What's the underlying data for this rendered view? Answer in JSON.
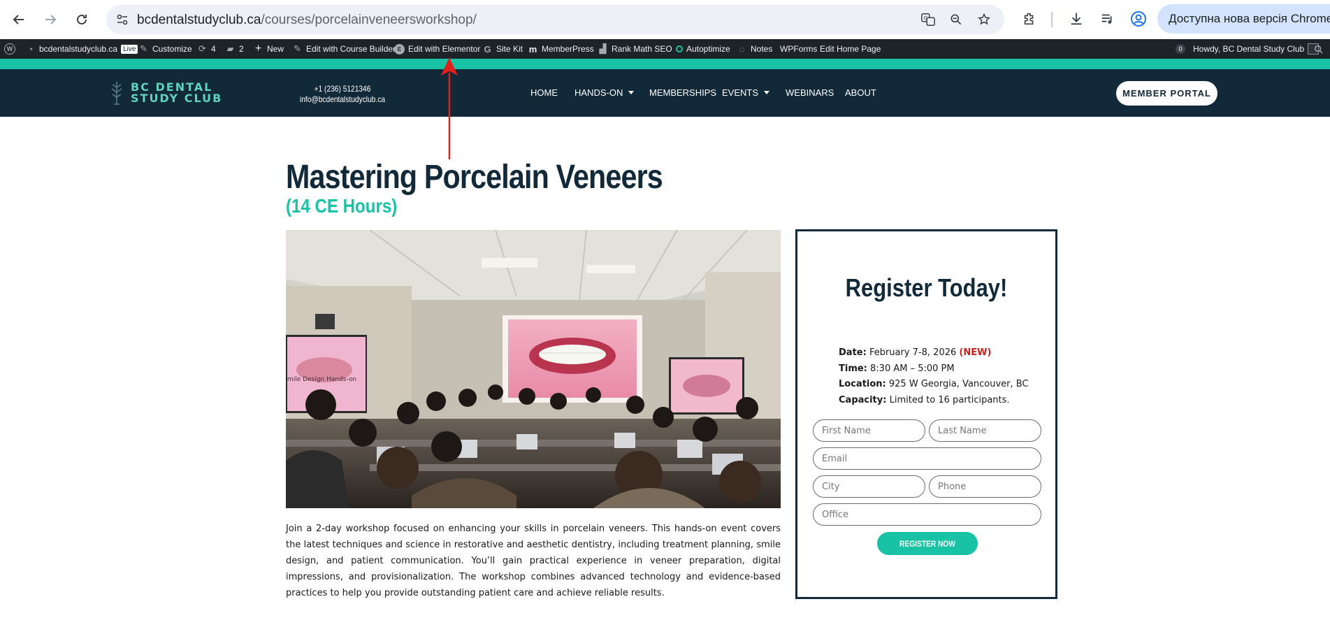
{
  "browser": {
    "url_host": "bcdentalstudyclub.ca",
    "url_path": "/courses/porcelainveneersworkshop/",
    "update_label": "Доступна нова версія Chrome"
  },
  "adminbar": {
    "site": "bcdentalstudyclub.ca",
    "live": "Live",
    "customize": "Customize",
    "updates_count": "4",
    "comments_count": "2",
    "new": "New",
    "course_builder": "Edit with Course Builder",
    "elementor": "Edit with Elementor",
    "site_kit": "Site Kit",
    "memberpress": "MemberPress",
    "rank_math": "Rank Math SEO",
    "autoptimize": "Autoptimize",
    "notes": "Notes",
    "wpforms": "WPForms",
    "edit_home": "Edit Home Page",
    "notif_count": "0",
    "howdy": "Howdy, BC Dental Study Club"
  },
  "header": {
    "logo_line1": "BC DENTAL",
    "logo_line2": "STUDY CLUB",
    "phone": "+1 (236) 5121346",
    "email": "info@bcdentalstudyclub.ca",
    "nav": [
      "HOME",
      "HANDS-ON",
      "MEMBERSHIPS",
      "EVENTS",
      "WEBINARS",
      "ABOUT"
    ],
    "portal": "MEMBER PORTAL"
  },
  "course": {
    "title": "Mastering Porcelain Veneers",
    "subtitle": "(14 CE Hours)",
    "photo_caption_text": "mile Design Hands-on",
    "description": "Join a 2-day workshop focused on enhancing your skills in porcelain veneers. This hands-on event covers the latest techniques and science in restorative and aesthetic dentistry, including treatment planning, smile design, and patient communication. You’ll gain practical experience in veneer preparation, digital impressions, and provisionalization. The workshop combines advanced technology and evidence-based practices to help you provide outstanding patient care and achieve reliable results."
  },
  "register": {
    "title": "Register Today!",
    "date_label": "Date:",
    "date_value": "February 7-8, 2026",
    "date_tag": "(NEW)",
    "time_label": "Time:",
    "time_value": "8:30 AM – 5:00 PM",
    "location_label": "Location:",
    "location_value": "925 W Georgia, Vancouver, BC",
    "capacity_label": "Capacity:",
    "capacity_value": "Limited to 16 participants.",
    "fields": {
      "first_name": "First Name",
      "last_name": "Last Name",
      "email": "Email",
      "city": "City",
      "phone": "Phone",
      "office": "Office"
    },
    "button": "REGISTER NOW"
  },
  "colors": {
    "teal": "#17c3a4",
    "navy": "#12293a",
    "annotation_arrow": "#e0201c"
  }
}
